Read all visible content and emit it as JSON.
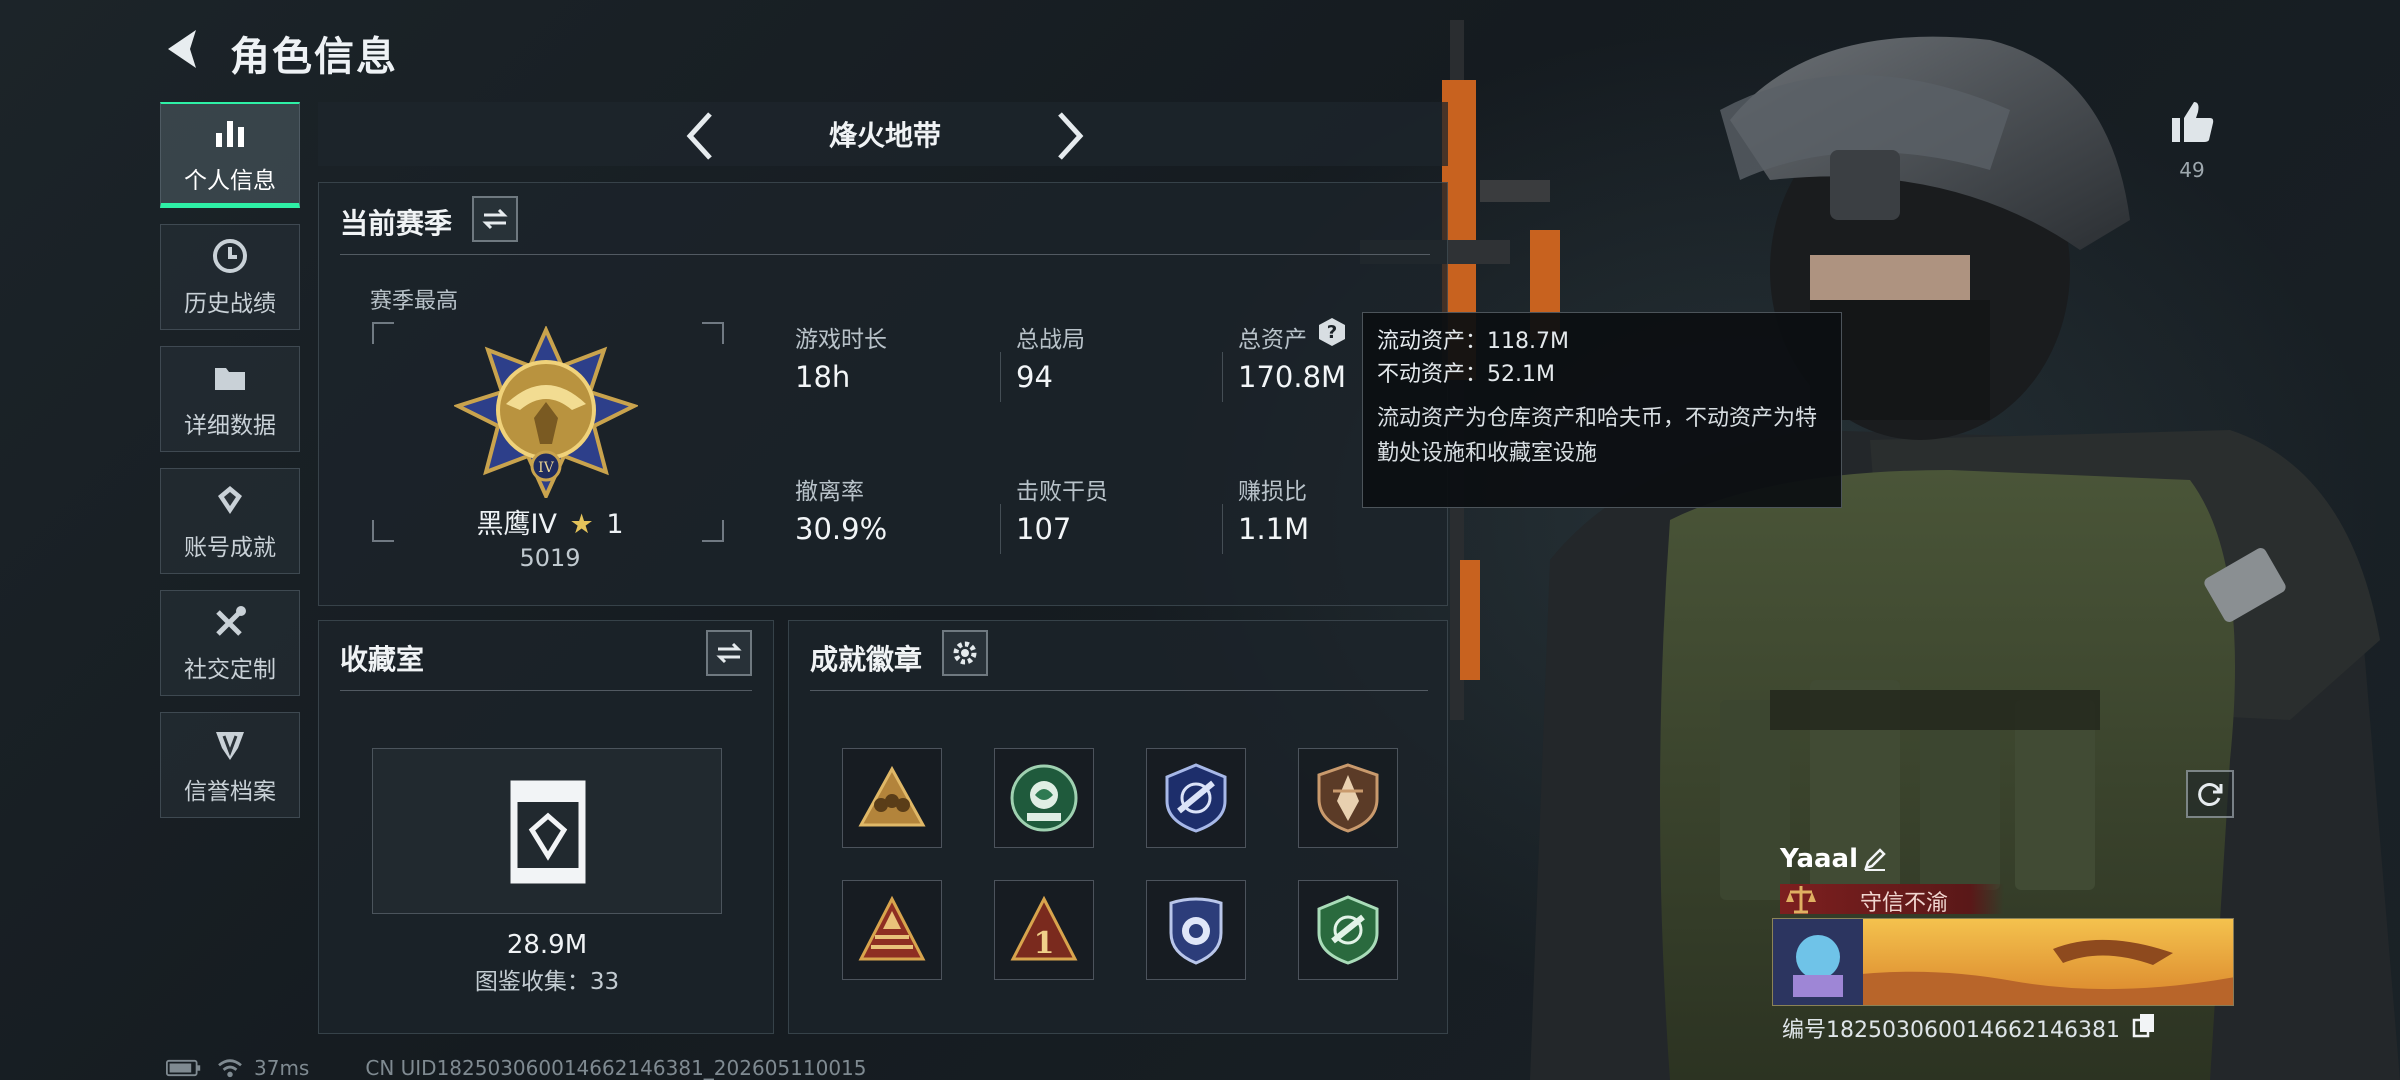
{
  "header": {
    "title": "角色信息"
  },
  "sidebar": {
    "items": [
      {
        "label": "个人信息",
        "icon": "bar-chart-icon",
        "active": true
      },
      {
        "label": "历史战绩",
        "icon": "clock-icon"
      },
      {
        "label": "详细数据",
        "icon": "folder-icon"
      },
      {
        "label": "账号成就",
        "icon": "achievement-icon"
      },
      {
        "label": "社交定制",
        "icon": "tools-icon"
      },
      {
        "label": "信誉档案",
        "icon": "reputation-icon"
      }
    ]
  },
  "mode_bar": {
    "title": "烽火地带"
  },
  "season": {
    "title": "当前赛季",
    "best_label": "赛季最高",
    "rank_name": "黑鹰IV",
    "rank_stars": "1",
    "rank_score": "5019",
    "stats": [
      {
        "label": "游戏时长",
        "value": "18h"
      },
      {
        "label": "总战局",
        "value": "94"
      },
      {
        "label": "总资产",
        "value": "170.8M"
      },
      {
        "label": "撤离率",
        "value": "30.9%"
      },
      {
        "label": "击败干员",
        "value": "107"
      },
      {
        "label": "赚损比",
        "value": "1.1M"
      }
    ]
  },
  "tooltip": {
    "liquid": "流动资产：118.7M",
    "fixed": "不动资产：52.1M",
    "note": "流动资产为仓库资产和哈夫币，不动资产为特勤处设施和收藏室设施"
  },
  "collection": {
    "title": "收藏室",
    "value": "28.9M",
    "count_text": "图鉴收集：33"
  },
  "badges": {
    "title": "成就徽章",
    "items": [
      {
        "icon": "triangle-team-badge-icon"
      },
      {
        "icon": "green-rose-badge-icon"
      },
      {
        "icon": "blue-wrench-shield-badge-icon"
      },
      {
        "icon": "bronze-shield-badge-icon"
      },
      {
        "icon": "pyramid-badge-icon"
      },
      {
        "icon": "number-one-triangle-badge-icon"
      },
      {
        "icon": "police-badge-icon"
      },
      {
        "icon": "green-shield-badge-icon"
      }
    ]
  },
  "player": {
    "likes": "49",
    "name": "Yaaal",
    "title_tag": "守信不渝",
    "id": "编号182503060014662146381"
  },
  "status": {
    "ping": "37ms",
    "uid": "CN UID182503060014662146381_202605110015"
  },
  "colors": {
    "accent": "#2ef0a6",
    "tag_red": "#7d1f1f"
  }
}
